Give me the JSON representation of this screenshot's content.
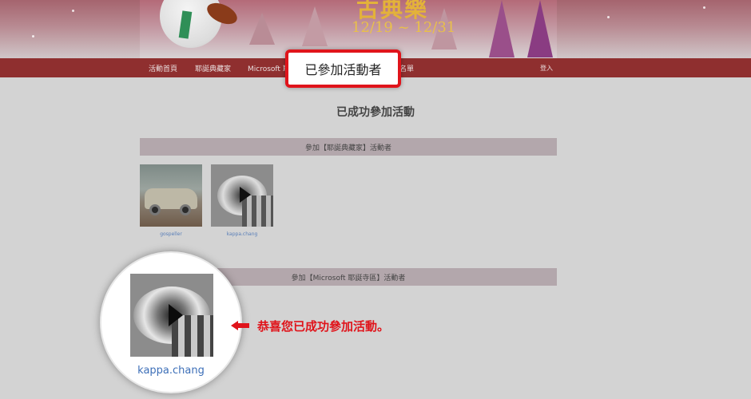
{
  "banner": {
    "title": "古典樂",
    "dates": "12/19 ~ 12/31"
  },
  "nav": {
    "items": [
      "活動首頁",
      "耶誕典藏家",
      "Microsoft 耶",
      "名單"
    ],
    "login": "登入"
  },
  "callout": {
    "label": "已參加活動者"
  },
  "page": {
    "heading": "已成功參加活動"
  },
  "sections": [
    {
      "title": "參加【耶誕典藏家】活動者",
      "participants": [
        {
          "name": "gospeller",
          "image": "vintage-car"
        },
        {
          "name": "kappa.chang",
          "image": "eye-clock"
        }
      ]
    },
    {
      "title": "參加【Microsoft 耶誕寺區】活動者",
      "participants": []
    }
  ],
  "zoom": {
    "name": "kappa.chang",
    "image": "eye-clock"
  },
  "annotation": {
    "message": "恭喜您已成功參加活動。",
    "color": "#e0141b"
  }
}
